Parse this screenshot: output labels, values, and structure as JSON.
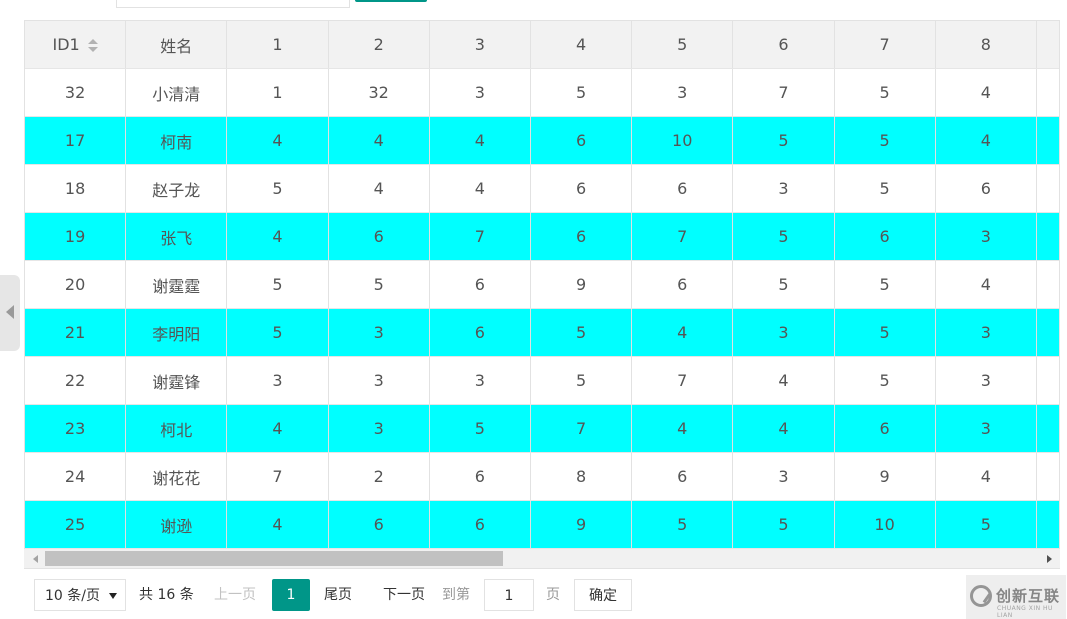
{
  "table": {
    "headers": [
      "ID1",
      "姓名",
      "1",
      "2",
      "3",
      "4",
      "5",
      "6",
      "7",
      "8"
    ],
    "rows": [
      [
        "32",
        "小清清",
        "1",
        "32",
        "3",
        "5",
        "3",
        "7",
        "5",
        "4"
      ],
      [
        "17",
        "柯南",
        "4",
        "4",
        "4",
        "6",
        "10",
        "5",
        "5",
        "4"
      ],
      [
        "18",
        "赵子龙",
        "5",
        "4",
        "4",
        "6",
        "6",
        "3",
        "5",
        "6"
      ],
      [
        "19",
        "张飞",
        "4",
        "6",
        "7",
        "6",
        "7",
        "5",
        "6",
        "3"
      ],
      [
        "20",
        "谢霆霆",
        "5",
        "5",
        "6",
        "9",
        "6",
        "5",
        "5",
        "4"
      ],
      [
        "21",
        "李明阳",
        "5",
        "3",
        "6",
        "5",
        "4",
        "3",
        "5",
        "3"
      ],
      [
        "22",
        "谢霆锋",
        "3",
        "3",
        "3",
        "5",
        "7",
        "4",
        "5",
        "3"
      ],
      [
        "23",
        "柯北",
        "4",
        "3",
        "5",
        "7",
        "4",
        "4",
        "6",
        "3"
      ],
      [
        "24",
        "谢花花",
        "7",
        "2",
        "6",
        "8",
        "6",
        "3",
        "9",
        "4"
      ],
      [
        "25",
        "谢逊",
        "4",
        "6",
        "6",
        "9",
        "5",
        "5",
        "10",
        "5"
      ]
    ],
    "highlight_color": "#00ffff"
  },
  "pager": {
    "page_size": "10 条/页",
    "total": "共 16 条",
    "prev": "上一页",
    "current": "1",
    "last": "尾页",
    "next": "下一页",
    "goto_label": "到第",
    "goto_value": "1",
    "goto_unit": "页",
    "confirm": "确定"
  },
  "watermark": {
    "text": "创新互联",
    "sub": "CHUANG XIN HU LIAN"
  },
  "colors": {
    "accent": "#009688",
    "highlight": "#00ffff"
  }
}
